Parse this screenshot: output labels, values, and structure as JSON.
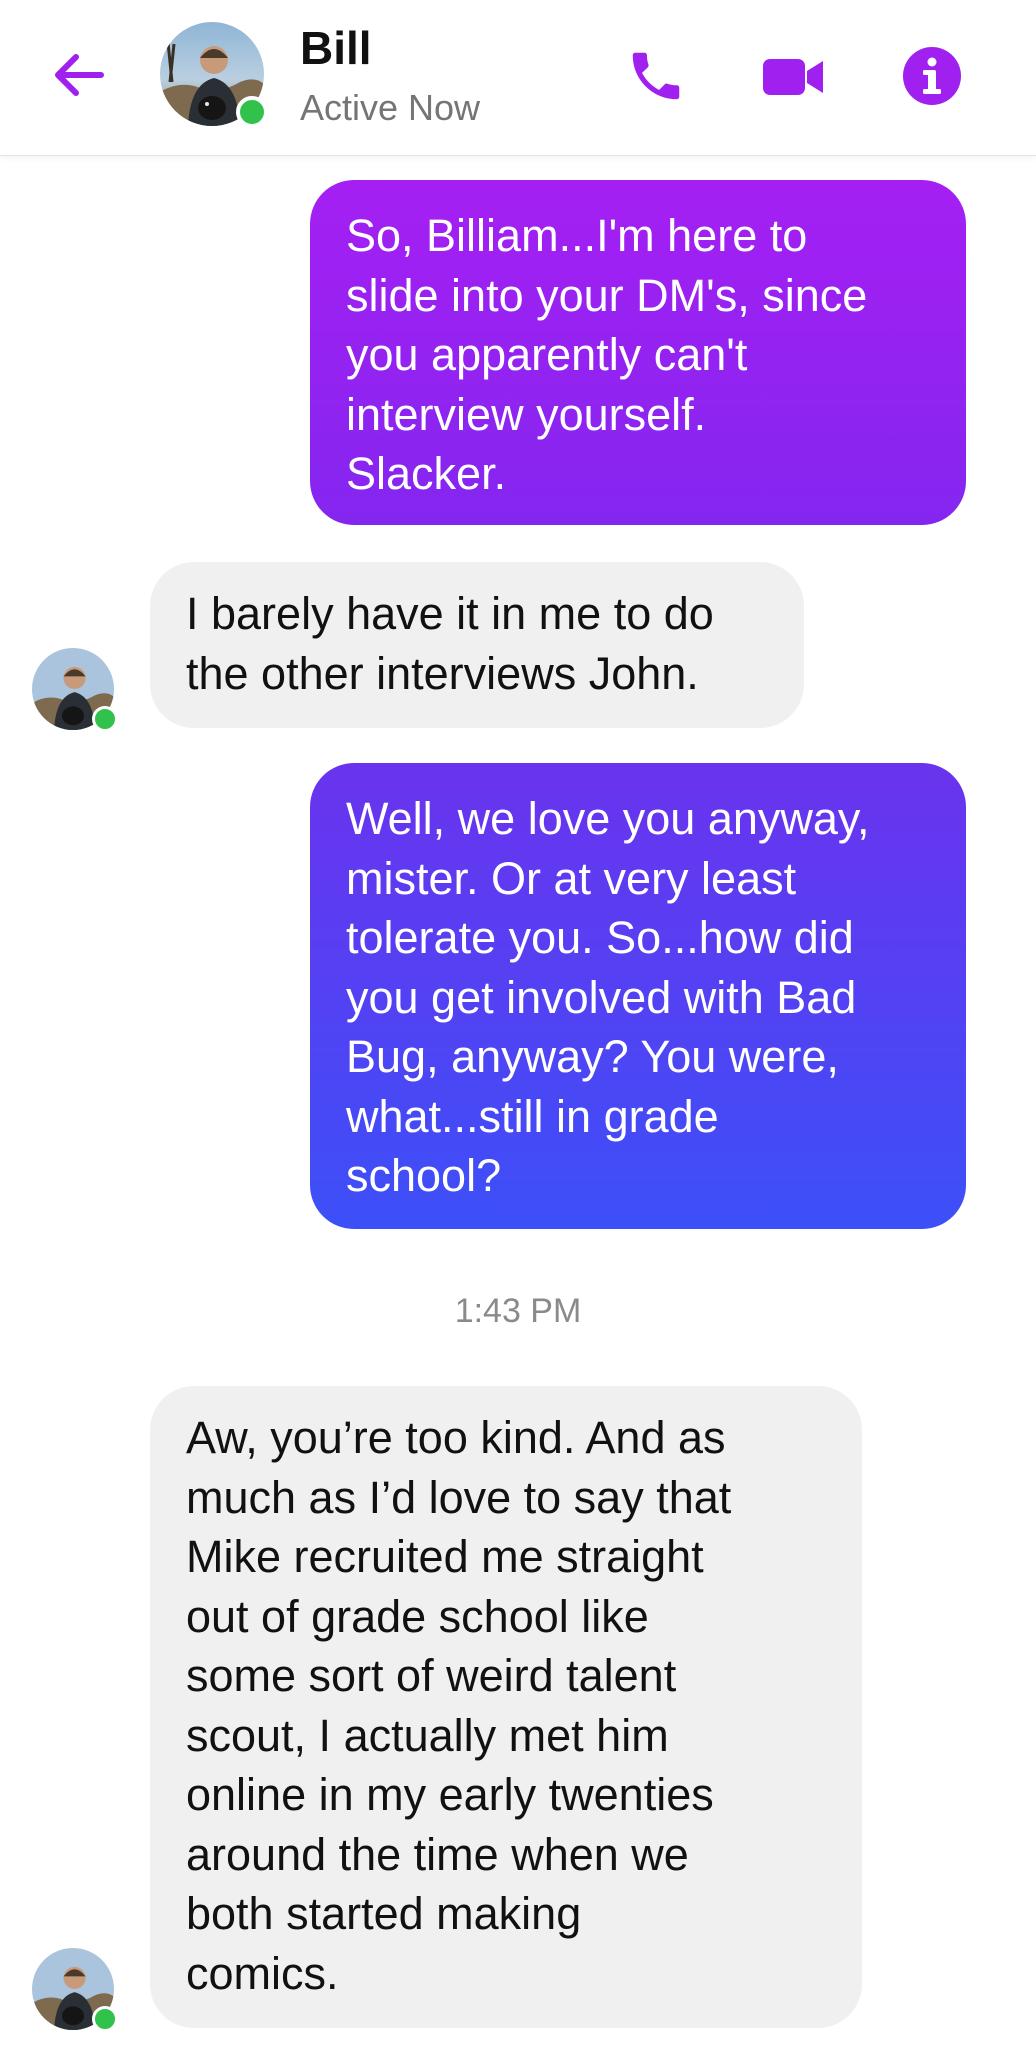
{
  "header": {
    "contact_name": "Bill",
    "status": "Active Now",
    "accent_color": "#a020f0",
    "presence_color": "#31c24c",
    "icons": [
      "back-arrow-icon",
      "phone-icon",
      "video-camera-icon",
      "info-icon"
    ]
  },
  "messages": [
    {
      "direction": "sent",
      "lines": [
        "So, Billiam...I'm here to",
        "slide into your DM's, since",
        "you apparently can't",
        "interview yourself.",
        "Slacker."
      ]
    },
    {
      "direction": "received",
      "lines": [
        "I barely have it in me to do",
        "the other interviews John."
      ]
    },
    {
      "direction": "sent",
      "lines": [
        "Well, we love you anyway,",
        "mister. Or at very least",
        "tolerate you. So...how did",
        "you get involved with Bad",
        "Bug, anyway? You were,",
        "what...still in grade",
        "school?"
      ]
    },
    {
      "direction": "received",
      "lines": [
        "Aw, you’re too kind. And as",
        "much as I’d love to say that",
        "Mike recruited me straight",
        "out of grade school like",
        "some sort of weird talent",
        "scout, I actually met him",
        "online in my early twenties",
        "around the time when we",
        "both started making",
        "comics."
      ]
    }
  ],
  "timestamp": "1:43 PM"
}
